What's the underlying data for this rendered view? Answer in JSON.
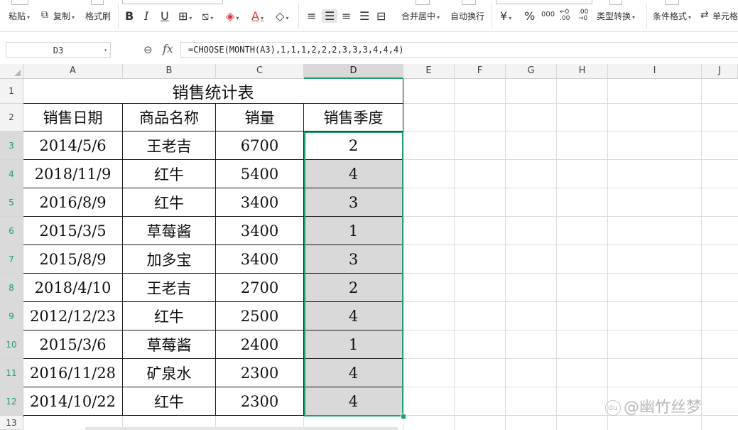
{
  "ribbon": {
    "paste": "粘贴",
    "copy": "复制",
    "format_painter": "格式刷",
    "bold": "B",
    "italic": "I",
    "underline": "U",
    "merge_center": "合并居中",
    "wrap_text": "自动换行",
    "currency": "¥",
    "percent": "%",
    "thousands": "000",
    "dec_increase": "←0 .00",
    "dec_decrease": ".00 →0",
    "type_convert": "类型转换",
    "conditional_format": "条件格式",
    "cell_style": "单元格"
  },
  "formula_bar": {
    "name_box": "D3",
    "fx": "fx",
    "formula": "=CHOOSE(MONTH(A3),1,1,1,2,2,2,3,3,3,4,4,4)"
  },
  "columns": [
    "A",
    "B",
    "C",
    "D",
    "E",
    "F",
    "G",
    "H",
    "I",
    "J"
  ],
  "row_numbers": [
    "1",
    "2",
    "3",
    "4",
    "5",
    "6",
    "7",
    "8",
    "9",
    "10",
    "11",
    "12",
    "13"
  ],
  "sheet": {
    "title": "销售统计表",
    "headers": [
      "销售日期",
      "商品名称",
      "销量",
      "销售季度"
    ],
    "rows": [
      [
        "2014/5/6",
        "王老吉",
        "6700",
        "2"
      ],
      [
        "2018/11/9",
        "红牛",
        "5400",
        "4"
      ],
      [
        "2016/8/9",
        "红牛",
        "3400",
        "3"
      ],
      [
        "2015/3/5",
        "草莓酱",
        "3400",
        "1"
      ],
      [
        "2015/8/9",
        "加多宝",
        "3400",
        "3"
      ],
      [
        "2018/4/10",
        "王老吉",
        "2700",
        "2"
      ],
      [
        "2012/12/23",
        "红牛",
        "2500",
        "4"
      ],
      [
        "2015/3/6",
        "草莓酱",
        "2400",
        "1"
      ],
      [
        "2016/11/28",
        "矿泉水",
        "2300",
        "4"
      ],
      [
        "2014/10/22",
        "红牛",
        "2300",
        "4"
      ]
    ]
  },
  "watermark": "@幽竹丝梦",
  "colors": {
    "selection": "#1e9e6a",
    "selected_fill": "#d9d9d9",
    "header_bg": "#f3f3f3"
  }
}
